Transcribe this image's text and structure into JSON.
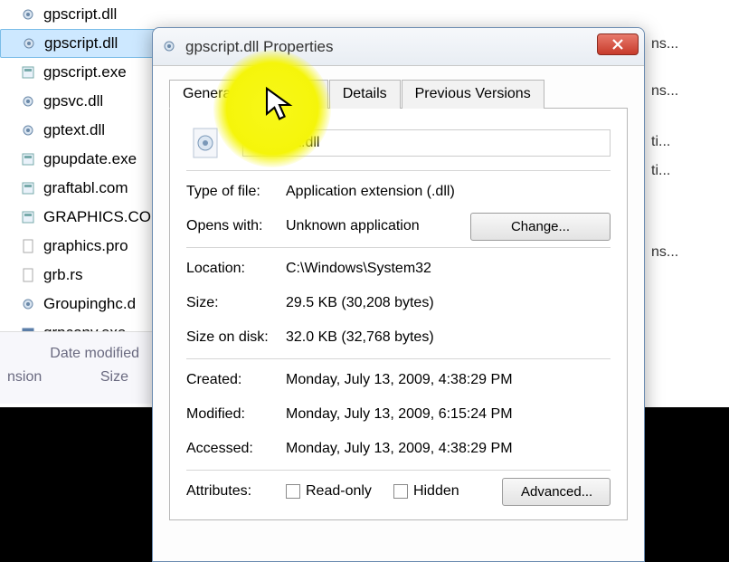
{
  "file_list": [
    {
      "name": "gpscript.dll",
      "icon": "gear-icon",
      "selected": true
    },
    {
      "name": "gpscript.exe",
      "icon": "app-icon"
    },
    {
      "name": "gpsvc.dll",
      "icon": "gear-icon"
    },
    {
      "name": "gptext.dll",
      "icon": "gear-icon"
    },
    {
      "name": "gpupdate.exe",
      "icon": "app-icon"
    },
    {
      "name": "graftabl.com",
      "icon": "app-icon"
    },
    {
      "name": "GRAPHICS.CO",
      "icon": "app-icon"
    },
    {
      "name": "graphics.pro",
      "icon": "file-icon"
    },
    {
      "name": "grb.rs",
      "icon": "file-icon"
    },
    {
      "name": "Groupinghc.d",
      "icon": "gear-icon"
    },
    {
      "name": "grpconv.exe",
      "icon": "calendar-icon"
    }
  ],
  "right_col_snips": [
    "ns...",
    "ns...",
    "ti...",
    "ti...",
    "ns..."
  ],
  "details_pane": {
    "date_label": "Date modified",
    "size_label": "Size",
    "ext_label": "nsion"
  },
  "dialog": {
    "title": "gpscript.dll Properties",
    "tabs": [
      "General",
      "Security",
      "Details",
      "Previous Versions"
    ],
    "active_tab": "General",
    "filename": "gpscript.dll",
    "rows": {
      "type_label": "Type of file:",
      "type_value": "Application extension (.dll)",
      "opens_label": "Opens with:",
      "opens_value": "Unknown application",
      "change_label": "Change...",
      "location_label": "Location:",
      "location_value": "C:\\Windows\\System32",
      "size_label": "Size:",
      "size_value": "29.5 KB (30,208 bytes)",
      "disk_label": "Size on disk:",
      "disk_value": "32.0 KB (32,768 bytes)",
      "created_label": "Created:",
      "created_value": "Monday, July 13, 2009, 4:38:29 PM",
      "modified_label": "Modified:",
      "modified_value": "Monday, July 13, 2009, 6:15:24 PM",
      "accessed_label": "Accessed:",
      "accessed_value": "Monday, July 13, 2009, 4:38:29 PM",
      "attributes_label": "Attributes:",
      "readonly_label": "Read-only",
      "hidden_label": "Hidden",
      "advanced_label": "Advanced..."
    }
  }
}
